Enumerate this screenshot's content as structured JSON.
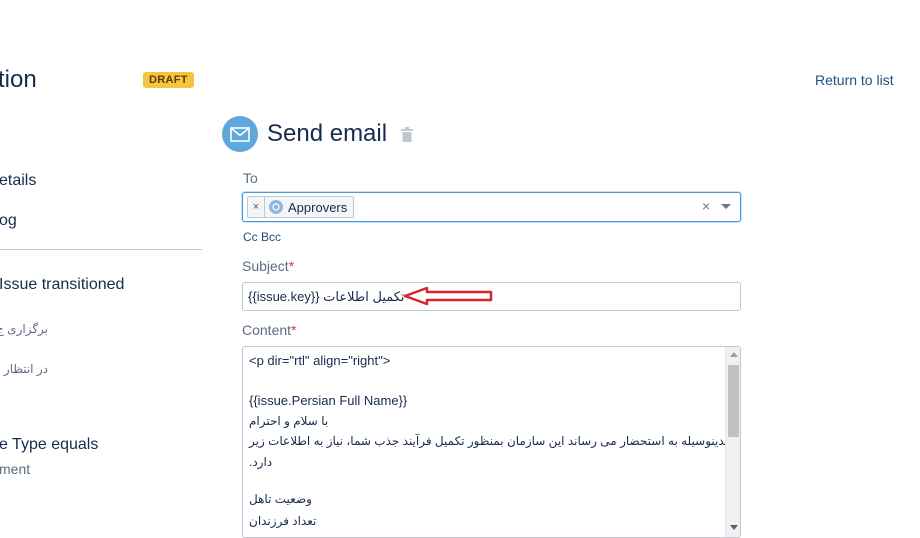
{
  "header": {
    "title_fragment": "tion",
    "status_badge": "DRAFT",
    "return_link": "Return to list"
  },
  "sidebar": {
    "items": [
      {
        "label": "etails"
      },
      {
        "label": "og"
      },
      {
        "label": "Issue transitioned"
      },
      {
        "label": "برگزاری ج"
      },
      {
        "label": "در انتظار ت"
      },
      {
        "label": "e Type equals"
      },
      {
        "label": "ment"
      }
    ]
  },
  "action": {
    "title": "Send email",
    "icon": "envelope-icon",
    "delete_icon": "trash-icon"
  },
  "form": {
    "to": {
      "label": "To",
      "chips": [
        {
          "label": "Approvers",
          "icon": "group-icon"
        }
      ],
      "remove_chip_symbol": "×",
      "clear_symbol": "×"
    },
    "cc_label": "Cc",
    "bcc_label": "Bcc",
    "subject": {
      "label": "Subject",
      "required_mark": "*",
      "value": "تکمیل اطلاعات {{issue.key}}"
    },
    "content": {
      "label": "Content",
      "required_mark": "*",
      "lines": [
        "<p dir=\"rtl\" align=\"right\">",
        "",
        "{{issue.Persian Full Name}}",
        "با سلام و احترام",
        "بدینوسیله به استحضار می رساند این سازمان بمنظور تکمیل فرآیند جذب شما، نیاز به اطلاعات زیر",
        "دارد.",
        "",
        "وضعیت تاهل",
        "تعداد فرزندان"
      ]
    }
  },
  "colors": {
    "accent": "#4a9ae1",
    "link": "#205081",
    "badge": "#f6c342",
    "required": "#d04437",
    "annotation": "#d9262e"
  }
}
